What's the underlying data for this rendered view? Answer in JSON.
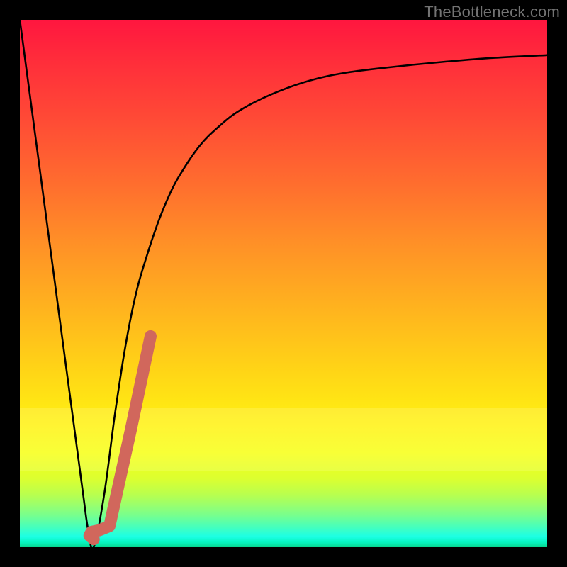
{
  "watermark": "TheBottleneck.com",
  "colors": {
    "frame": "#000000",
    "curve": "#000000",
    "marker": "#d1675c",
    "gradient_top": "#ff163f",
    "gradient_bottom": "#07d68f"
  },
  "chart_data": {
    "type": "line",
    "title": "",
    "xlabel": "",
    "ylabel": "",
    "xlim": [
      0,
      100
    ],
    "ylim": [
      0,
      100
    ],
    "grid": false,
    "legend": false,
    "series": [
      {
        "name": "bottleneck-curve",
        "x": [
          0,
          4,
          8,
          10,
          12,
          13,
          14,
          16,
          18,
          20,
          22,
          24,
          26,
          28,
          30,
          34,
          38,
          42,
          48,
          55,
          62,
          70,
          80,
          90,
          100
        ],
        "values": [
          100,
          70,
          40,
          25,
          10,
          3,
          0,
          10,
          25,
          38,
          48,
          55,
          61,
          66,
          70,
          76,
          80,
          83,
          86,
          88.5,
          90,
          91,
          92,
          92.8,
          93.3
        ]
      }
    ],
    "marker_segment": {
      "name": "highlighted-range",
      "path": [
        {
          "x": 14.0,
          "y": 1.5
        },
        {
          "x": 13.2,
          "y": 2.2
        },
        {
          "x": 13.6,
          "y": 2.9
        },
        {
          "x": 15.0,
          "y": 3.2
        },
        {
          "x": 17.0,
          "y": 4.0
        },
        {
          "x": 21.0,
          "y": 22.0
        },
        {
          "x": 24.8,
          "y": 40.0
        }
      ]
    }
  }
}
